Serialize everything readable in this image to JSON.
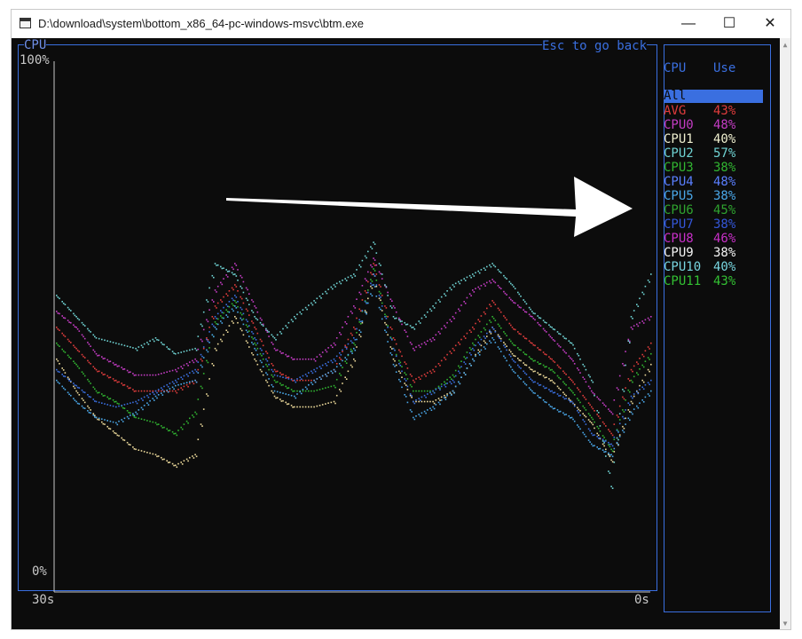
{
  "window": {
    "title": "D:\\download\\system\\bottom_x86_64-pc-windows-msvc\\btm.exe",
    "minimize_glyph": "—",
    "maximize_glyph": "☐",
    "close_glyph": "✕"
  },
  "graph_panel": {
    "title": "CPU",
    "hint": "Esc to go back",
    "y_max_label": "100%",
    "y_min_label": "0%",
    "x_start_label": "30s",
    "x_end_label": "0s"
  },
  "legend_panel": {
    "header_cpu": "CPU",
    "header_use": "Use",
    "selected_label": "All",
    "rows": [
      {
        "name": "AVG",
        "use": "43%",
        "color": "#e03c3c"
      },
      {
        "name": "CPU0",
        "use": "48%",
        "color": "#c43cc4"
      },
      {
        "name": "CPU1",
        "use": "40%",
        "color": "#f0f0d0"
      },
      {
        "name": "CPU2",
        "use": "57%",
        "color": "#6fd3d3"
      },
      {
        "name": "CPU3",
        "use": "38%",
        "color": "#31b531"
      },
      {
        "name": "CPU4",
        "use": "48%",
        "color": "#5a7fff"
      },
      {
        "name": "CPU5",
        "use": "38%",
        "color": "#4aa7e8"
      },
      {
        "name": "CPU6",
        "use": "45%",
        "color": "#2fa32f"
      },
      {
        "name": "CPU7",
        "use": "38%",
        "color": "#3456d8"
      },
      {
        "name": "CPU8",
        "use": "46%",
        "color": "#c82fc8"
      },
      {
        "name": "CPU9",
        "use": "38%",
        "color": "#f5f5f5"
      },
      {
        "name": "CPU10",
        "use": "40%",
        "color": "#78d6e0"
      },
      {
        "name": "CPU11",
        "use": "43%",
        "color": "#33c133"
      }
    ]
  },
  "colors": {
    "border": "#3a6fe0",
    "selected_bg": "#3a6fe0",
    "text": "#c8c8c8",
    "series": {
      "red": "#e03c3c",
      "magenta": "#c43cc4",
      "yellow": "#ecd99a",
      "cyan": "#6fd3d3",
      "green": "#31b531",
      "blue": "#3a6fe0",
      "lightblue": "#4aa7e8"
    }
  },
  "annotation": {
    "arrow_color": "#ffffff"
  },
  "chart_data": {
    "type": "scatter",
    "x": [
      30,
      29,
      28,
      27,
      26,
      25,
      24,
      23,
      22,
      21,
      20,
      19,
      18,
      17,
      16,
      15,
      14,
      13,
      12,
      11,
      10,
      9,
      8,
      7,
      6,
      5,
      4,
      3,
      2,
      1,
      0
    ],
    "ylim": [
      0,
      100
    ],
    "xlim": [
      30,
      0
    ],
    "series": [
      {
        "color": "#e03c3c",
        "values": [
          50,
          46,
          42,
          40,
          38,
          38,
          38,
          40,
          54,
          58,
          50,
          42,
          40,
          40,
          42,
          50,
          62,
          48,
          40,
          42,
          46,
          50,
          55,
          50,
          47,
          44,
          40,
          35,
          30,
          42,
          47
        ]
      },
      {
        "color": "#c43cc4",
        "values": [
          53,
          50,
          45,
          43,
          41,
          41,
          42,
          44,
          57,
          62,
          54,
          46,
          44,
          44,
          47,
          54,
          63,
          54,
          46,
          48,
          52,
          57,
          59,
          55,
          52,
          48,
          44,
          38,
          34,
          50,
          52
        ]
      },
      {
        "color": "#ecd99a",
        "values": [
          44,
          38,
          33,
          30,
          27,
          26,
          24,
          26,
          46,
          52,
          44,
          37,
          35,
          35,
          36,
          44,
          60,
          44,
          36,
          36,
          38,
          44,
          50,
          45,
          42,
          40,
          36,
          32,
          25,
          36,
          43
        ]
      },
      {
        "color": "#6fd3d3",
        "values": [
          56,
          52,
          48,
          47,
          46,
          48,
          45,
          46,
          62,
          60,
          52,
          48,
          52,
          55,
          58,
          60,
          66,
          52,
          50,
          54,
          58,
          60,
          62,
          58,
          53,
          50,
          47,
          40,
          20,
          52,
          60
        ]
      },
      {
        "color": "#31b531",
        "values": [
          47,
          43,
          38,
          36,
          33,
          32,
          30,
          34,
          51,
          55,
          47,
          40,
          38,
          38,
          39,
          47,
          61,
          46,
          38,
          38,
          41,
          47,
          52,
          47,
          44,
          42,
          38,
          33,
          27,
          40,
          45
        ]
      },
      {
        "color": "#3a6fe0",
        "values": [
          42,
          39,
          36,
          35,
          36,
          38,
          40,
          42,
          52,
          56,
          48,
          41,
          40,
          42,
          44,
          48,
          60,
          46,
          36,
          38,
          40,
          46,
          50,
          44,
          40,
          38,
          36,
          30,
          28,
          37,
          40
        ]
      },
      {
        "color": "#4aa7e8",
        "values": [
          40,
          36,
          33,
          32,
          34,
          37,
          39,
          40,
          50,
          54,
          46,
          38,
          37,
          40,
          42,
          46,
          58,
          43,
          33,
          35,
          38,
          44,
          48,
          42,
          38,
          35,
          33,
          28,
          26,
          34,
          38
        ]
      }
    ]
  }
}
